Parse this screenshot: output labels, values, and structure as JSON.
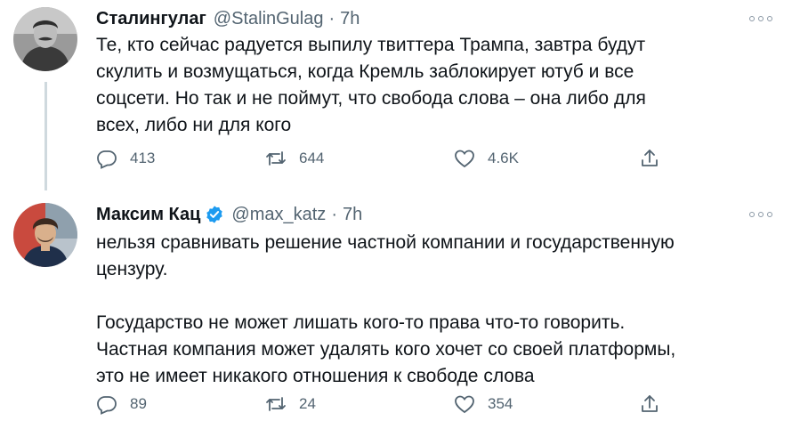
{
  "tweets": [
    {
      "author": "Сталингулаг",
      "handle": "@StalinGulag",
      "separator": "·",
      "time": "7h",
      "text": "Те, кто сейчас радуется выпилу твиттера Трампа, завтра будут\nскулить и возмущаться, когда Кремль заблокирует ютуб и все\nсоцсети. Но так и не поймут, что свобода слова – она либо для\nвсех, либо ни для кого",
      "replies": "413",
      "retweets": "644",
      "likes": "4.6K"
    },
    {
      "author": "Максим Кац",
      "verified": true,
      "handle": "@max_katz",
      "separator": "·",
      "time": "7h",
      "text": "нельзя сравнивать решение частной компании и государственную\nцензуру.\n\nГосударство не может лишать кого-то права что-то говорить.\nЧастная компания может удалять кого хочет со своей платформы,\nэто не имеет никакого отношения к свободе слова",
      "replies": "89",
      "retweets": "24",
      "likes": "354"
    }
  ],
  "colors": {
    "text": "#0f1419",
    "secondary": "#536471",
    "verified": "#1d9bf0",
    "thread_line": "#cfd9de"
  },
  "icons": [
    "reply-icon",
    "retweet-icon",
    "like-icon",
    "share-icon",
    "more-icon",
    "verified-badge-icon"
  ]
}
